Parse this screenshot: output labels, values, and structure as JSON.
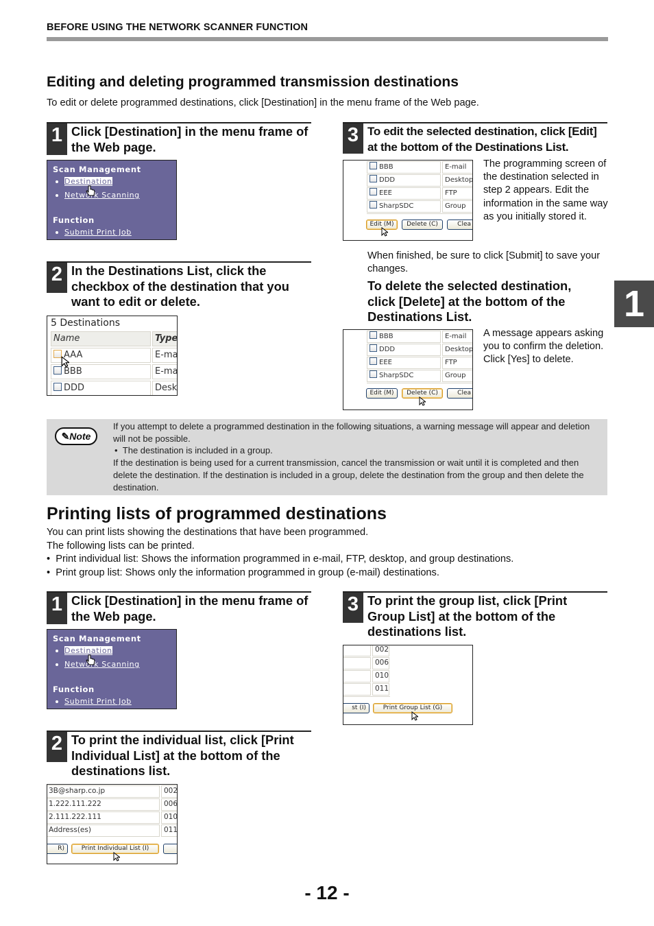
{
  "running_head": "BEFORE USING THE NETWORK SCANNER FUNCTION",
  "chapter_tab": "1",
  "page_number": "- 12 -",
  "section1": {
    "title": "Editing and deleting programmed transmission destinations",
    "intro": "To edit or delete programmed destinations, click [Destination] in the menu frame of the Web page.",
    "step1": {
      "num": "1",
      "text": "Click [Destination] in the menu frame of the Web page.",
      "menu": {
        "heading1": "Scan Management",
        "item_destination": "Destination",
        "item_network": "Network Scanning",
        "heading2": "Function",
        "item_submit": "Submit Print Job"
      }
    },
    "step2": {
      "num": "2",
      "text": "In the Destinations List, click the checkbox of the destination that you want to edit or delete.",
      "list": {
        "title": "5 Destinations",
        "col_name": "Name",
        "col_type": "Type",
        "rows": [
          {
            "name": "AAA",
            "type": "E-ma"
          },
          {
            "name": "BBB",
            "type": "E-ma"
          },
          {
            "name": "DDD",
            "type": "Desk"
          }
        ]
      }
    },
    "step3": {
      "num": "3",
      "text": "To edit the selected destination, click [Edit] at the bottom of the Destinations List.",
      "list_rows": [
        {
          "name": "BBB",
          "type": "E-mail"
        },
        {
          "name": "DDD",
          "type": "Desktop"
        },
        {
          "name": "EEE",
          "type": "FTP"
        },
        {
          "name": "SharpSDC",
          "type": "Group"
        }
      ],
      "buttons": {
        "edit": "Edit (M)",
        "delete": "Delete (C)",
        "clear": "Clea"
      },
      "side_text": "The programming screen of the destination selected in step 2 appears. Edit the information in the same way as you initially stored it.",
      "after_text": "When finished, be sure to click [Submit] to save your changes.",
      "delete_heading": "To delete the selected destination, click [Delete] at the bottom of the Destinations List.",
      "delete_side_text": "A message appears asking you to confirm the deletion. Click [Yes] to delete."
    },
    "note": {
      "badge": "Note",
      "line1": "If you attempt to delete a programmed destination in the following situations, a warning message will appear and deletion will not be possible.",
      "bullet": "The destination is included in a group.",
      "line2": "If the destination is being used for a current transmission, cancel the transmission or wait until it is completed and then delete the destination. If the destination is included in a group, delete the destination from the group and then delete the destination."
    }
  },
  "section2": {
    "title": "Printing lists of programmed destinations",
    "intro1": "You can print lists showing the destinations that have been programmed.",
    "intro2": "The following lists can be printed.",
    "bullets": [
      "Print individual list: Shows the information programmed in e-mail, FTP, desktop, and group destinations.",
      "Print group list: Shows only the information programmed in group (e-mail) destinations."
    ],
    "step1": {
      "num": "1",
      "text": "Click [Destination] in the menu frame of the Web page."
    },
    "step2": {
      "num": "2",
      "text": "To print the individual list, click [Print Individual List] at the bottom of the destinations list.",
      "rows": [
        {
          "addr": "3B@sharp.co.jp",
          "num": "002"
        },
        {
          "addr": "1.222.111.222",
          "num": "006"
        },
        {
          "addr": "2.111.222.111",
          "num": "010"
        },
        {
          "addr": "Address(es)",
          "num": "011"
        }
      ],
      "buttons": {
        "left": "R)",
        "print_individual": "Print Individual List (I)"
      }
    },
    "step3": {
      "num": "3",
      "text": "To print the group list, click [Print Group List] at the bottom of the destinations list.",
      "rows": [
        "002",
        "006",
        "010",
        "011"
      ],
      "buttons": {
        "left": "st (I)",
        "print_group": "Print Group List (G)"
      }
    }
  }
}
